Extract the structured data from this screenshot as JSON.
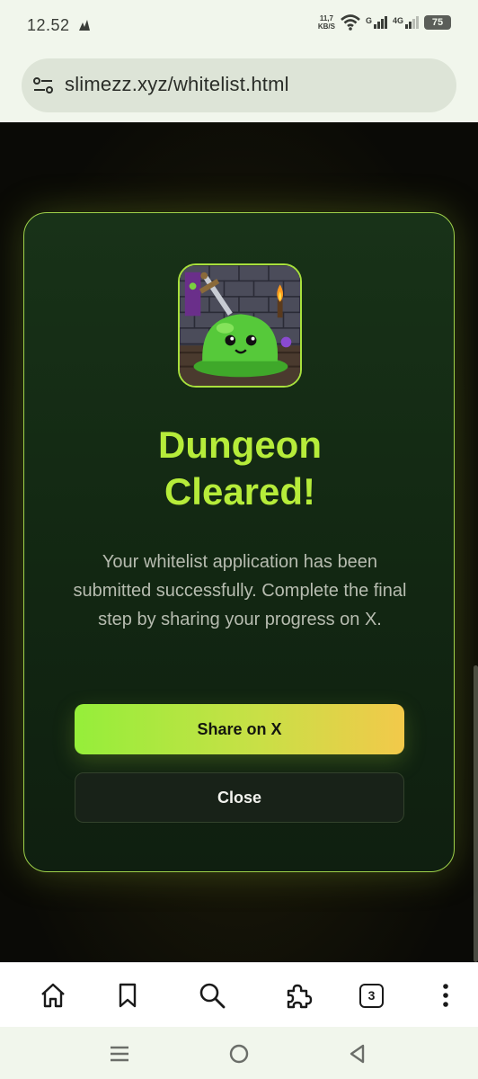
{
  "status_bar": {
    "time": "12.52",
    "net_speed_value": "11,7",
    "net_speed_unit": "KB/S",
    "signal_1_label": "G",
    "signal_2_label": "4G",
    "battery": "75"
  },
  "browser": {
    "url": "slimezz.xyz/whitelist.html",
    "tab_count": "3"
  },
  "modal": {
    "title_line1": "Dungeon",
    "title_line2": "Cleared!",
    "message": "Your whitelist application has been submitted successfully. Complete the final step by sharing your progress on X.",
    "share_label": "Share on X",
    "close_label": "Close"
  },
  "colors": {
    "accent_green": "#b6ec3a",
    "gradient_start": "#95ee3a",
    "gradient_end": "#f2c94a"
  },
  "icons": [
    "notification-icon",
    "wifi-icon",
    "signal-icon",
    "site-settings-icon",
    "home-icon",
    "bookmark-icon",
    "search-icon",
    "extensions-icon",
    "more-vert-icon",
    "recents-icon",
    "home-nav-icon",
    "back-icon"
  ]
}
